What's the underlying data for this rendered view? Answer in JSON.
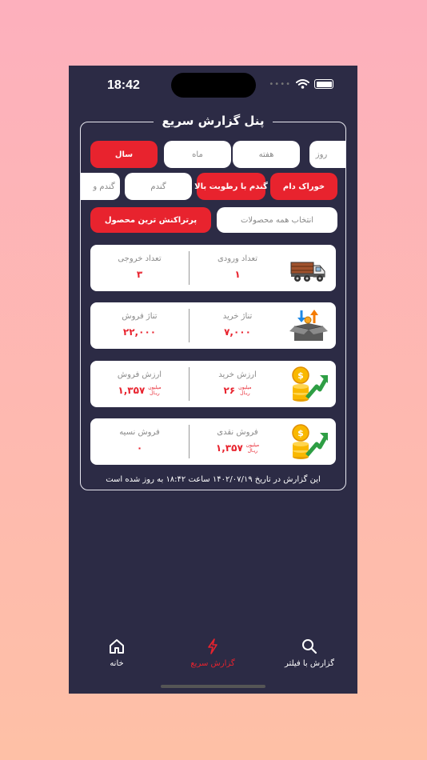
{
  "status": {
    "time": "18:42"
  },
  "panel": {
    "title": "پنل گزارش سریع"
  },
  "periods": [
    {
      "label": "روز",
      "active": false
    },
    {
      "label": "هفته",
      "active": false
    },
    {
      "label": "ماه",
      "active": false
    },
    {
      "label": "سال",
      "active": true
    }
  ],
  "products": [
    {
      "label": "خوراک دام",
      "active": true
    },
    {
      "label": "گندم با رطوبت بالا",
      "active": true
    },
    {
      "label": "گندم",
      "active": false
    },
    {
      "label": "گندم و",
      "active": false
    }
  ],
  "modes": [
    {
      "label": "انتخاب همه محصولات",
      "active": false
    },
    {
      "label": "پرتراکنش ترین محصول",
      "active": true
    }
  ],
  "cards": [
    {
      "icon": "truck-icon",
      "right_label": "تعداد ورودی",
      "right_value": "۱",
      "left_label": "تعداد خروجی",
      "left_value": "۳"
    },
    {
      "icon": "box-arrows-icon",
      "right_label": "تناژ خرید",
      "right_value": "۷,۰۰۰",
      "left_label": "تناژ فروش",
      "left_value": "۲۲,۰۰۰"
    },
    {
      "icon": "coins-growth-icon",
      "right_label": "ارزش خرید",
      "right_value": "۲۶",
      "left_label": "ارزش فروش",
      "left_value": "۱,۳۵۷",
      "unit_top": "میلیون",
      "unit_bottom": "ریـال"
    },
    {
      "icon": "coins-growth-icon",
      "right_label": "فروش نقدی",
      "right_value": "۱,۳۵۷",
      "left_label": "فروش نسیه",
      "left_value": "۰",
      "unit_top": "میلیون",
      "unit_bottom": "ریـال"
    }
  ],
  "updated_text": "این گزارش در تاریخ ۱۴۰۲/۰۷/۱۹ ساعت ۱۸:۴۲ به روز شده است",
  "tabs": [
    {
      "label": "خانه",
      "icon": "home-icon"
    },
    {
      "label": "گزارش سریع",
      "icon": "lightning-icon"
    },
    {
      "label": "گزارش با فیلتر",
      "icon": "search-icon"
    }
  ],
  "colors": {
    "accent": "#e8232e",
    "background": "#2c2b45"
  }
}
